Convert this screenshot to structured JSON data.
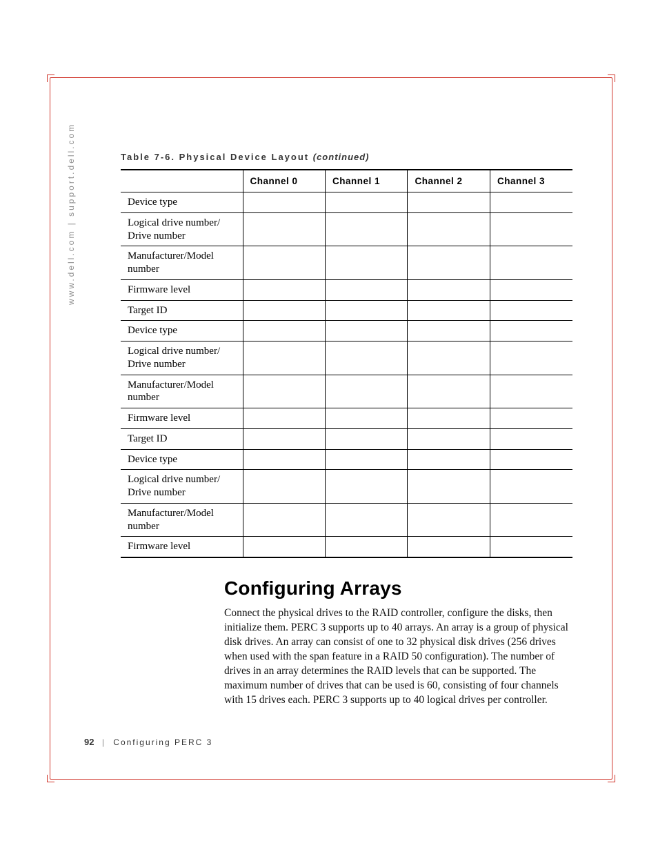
{
  "sidebar_text": "www.dell.com | support.dell.com",
  "table": {
    "caption_prefix": "Table 7-6. Physical Device Layout ",
    "caption_suffix": "(continued)",
    "headers": [
      "",
      "Channel 0",
      "Channel 1",
      "Channel 2",
      "Channel 3"
    ],
    "rows": [
      "Device type",
      "Logical drive number/ Drive number",
      "Manufacturer/Model number",
      "Firmware level",
      "Target ID",
      "Device type",
      "Logical drive number/ Drive number",
      "Manufacturer/Model number",
      "Firmware level",
      "Target ID",
      "Device type",
      "Logical drive number/ Drive number",
      "Manufacturer/Model number",
      "Firmware level"
    ]
  },
  "section": {
    "heading": "Configuring Arrays",
    "body": "Connect the physical drives to the RAID controller, configure the disks, then initialize them. PERC 3 supports up to 40 arrays. An array is a group of physical disk drives. An array can consist of one to 32 physical disk drives (256 drives when used with the span feature in a RAID 50 configuration). The number of drives in an array determines the RAID levels that can be supported. The maximum number of drives that can be used is 60, consisting of four channels with 15 drives each. PERC 3 supports up to 40 logical drives per controller."
  },
  "footer": {
    "page_number": "92",
    "separator": "|",
    "chapter": "Configuring PERC 3"
  }
}
